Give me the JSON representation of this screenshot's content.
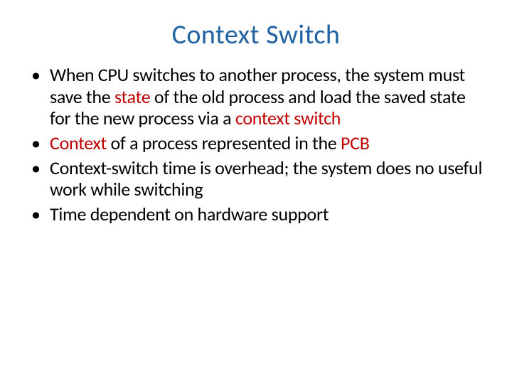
{
  "slide": {
    "title": "Context Switch",
    "bullets": [
      {
        "pre": "When CPU switches to another process, the system must save the ",
        "key1": "state",
        "mid": " of the old process and load the saved state for the new process via a ",
        "key2": "context switch"
      },
      {
        "pre": "",
        "key1": "Context",
        "mid": " of a process represented in the ",
        "key2": "PCB"
      },
      {
        "pre": "Context-switch time is overhead; the system does no useful work while switching",
        "key1": "",
        "mid": "",
        "key2": ""
      },
      {
        "pre": "Time dependent on hardware support",
        "key1": "",
        "mid": "",
        "key2": ""
      }
    ]
  }
}
